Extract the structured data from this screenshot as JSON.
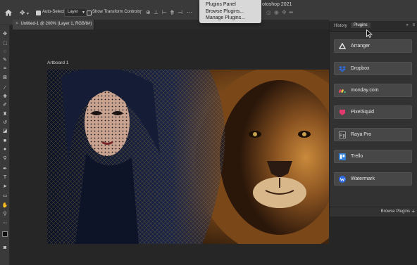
{
  "app": {
    "title_fragment": "otoshop 2021"
  },
  "optionsbar": {
    "auto_select_label": "Auto-Select:",
    "layer_select": "Layer",
    "show_transform_label": "Show Transform Controls"
  },
  "plugins_menu": {
    "items": [
      "Plugins Panel",
      "Browse Plugins...",
      "Manage Plugins..."
    ]
  },
  "document": {
    "tab_label": "Untitled-1 @ 200% (Layer 1, RGB/8#)",
    "close_glyph": "×",
    "artboard_label": "Artboard 1"
  },
  "panel": {
    "tabs": [
      "History",
      "Plugins"
    ],
    "active_tab": "Plugins",
    "collapse_glyph": "»",
    "menu_glyph": "≡",
    "plugins": [
      {
        "name": "Arranger",
        "icon": "arranger-icon",
        "color": "#e8e8e8"
      },
      {
        "name": "Dropbox",
        "icon": "dropbox-icon",
        "color": "#2f6be3"
      },
      {
        "name": "monday.com",
        "icon": "monday-icon",
        "color": "#f2c744"
      },
      {
        "name": "PixelSquid",
        "icon": "pixelsquid-icon",
        "color": "#e33a6d"
      },
      {
        "name": "Raya Pro",
        "icon": "raya-pro-icon",
        "color": "#cfcfcf"
      },
      {
        "name": "Trello",
        "icon": "trello-icon",
        "color": "#2f7fd6"
      },
      {
        "name": "Watermark",
        "icon": "watermark-icon",
        "color": "#2f6be3"
      }
    ],
    "browse_label": "Browse Plugins",
    "add_glyph": "+"
  }
}
